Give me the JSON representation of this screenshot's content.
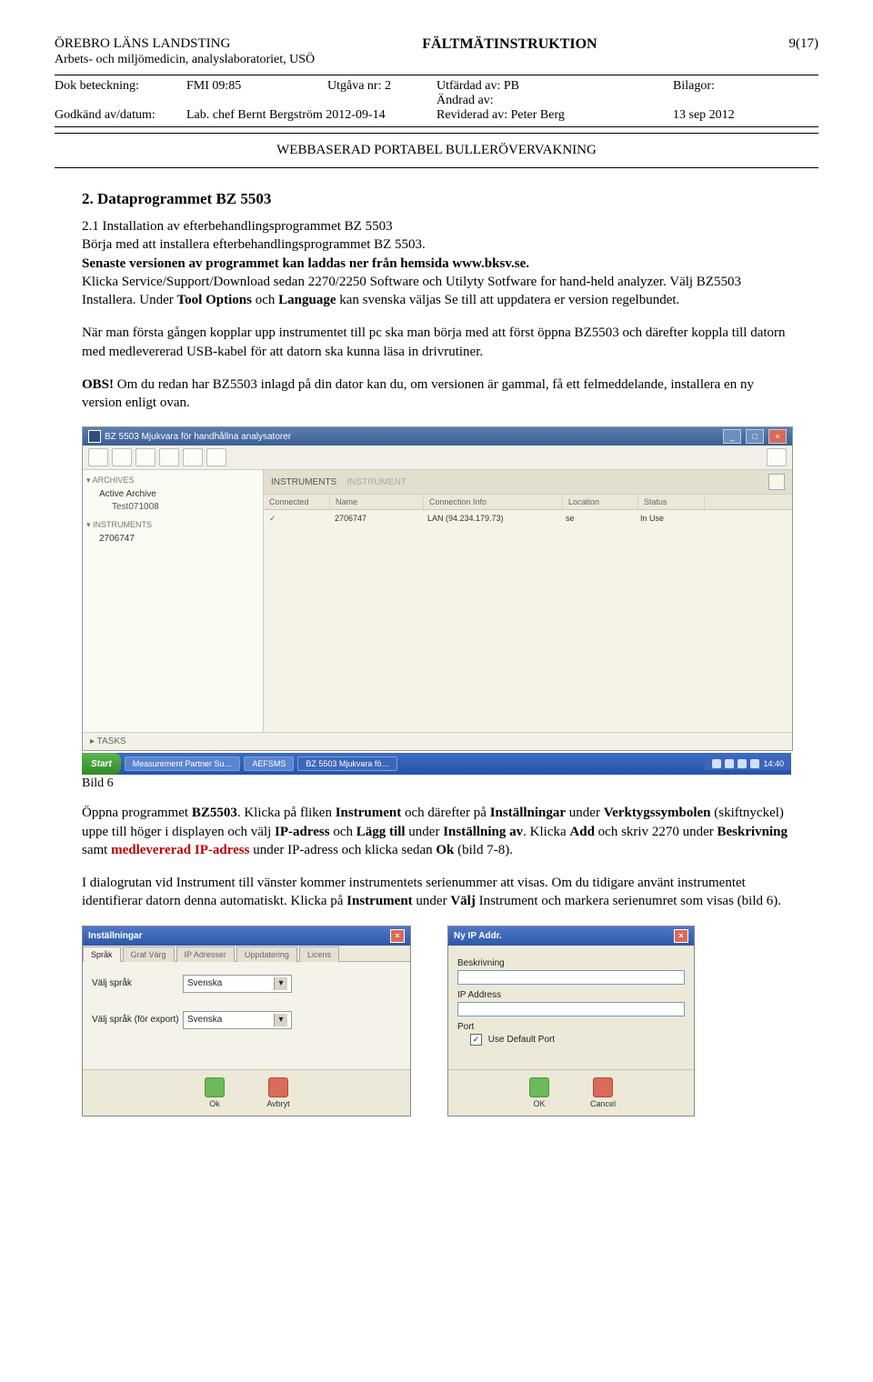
{
  "header": {
    "org": "ÖREBRO LÄNS LANDSTING",
    "title": "FÄLTMÄTINSTRUKTION",
    "page": "9(17)",
    "dept": "Arbets- och miljömedicin, analyslaboratoriet, USÖ",
    "row1": {
      "label1": "Dok beteckning:",
      "val1": "FMI 09:85",
      "label2": "Utgåva nr: 2",
      "val2a": "Utfärdad av: PB",
      "val2b": "Ändrad av:",
      "label3": "Bilagor:"
    },
    "row2": {
      "label1": "Godkänd av/datum:",
      "val1": "Lab. chef Bernt Bergström 2012-09-14",
      "val2": "Reviderad av: Peter Berg",
      "val3": "13 sep 2012"
    },
    "doc_title": "WEBBASERAD PORTABEL BULLERÖVERVAKNING"
  },
  "content": {
    "h2": "2. Dataprogrammet BZ 5503",
    "p1a": "2.1 Installation av efterbehandlingsprogrammet BZ 5503",
    "p1b": "Börja med att installera efterbehandlingsprogrammet BZ 5503.",
    "p1c": "Senaste versionen av programmet kan laddas ner från hemsida www.bksv.se.",
    "p1d": "Klicka Service/Support/Download sedan 2270/2250 Software och Utilyty Sotfware for hand-held analyzer. Välj BZ5503 Installera. Under ",
    "p1e_bold1": "Tool Options",
    "p1f": " och ",
    "p1e_bold2": "Language",
    "p1g": " kan svenska väljas Se till att uppdatera er version regelbundet.",
    "p2": "När man första gången kopplar upp instrumentet till pc ska man börja med att först öppna BZ5503 och därefter koppla till datorn med medlevererad USB-kabel för att datorn ska kunna läsa in drivrutiner.",
    "p3_a": "OBS!",
    "p3_b": " Om du redan har BZ5503 inlagd på din dator kan du, om versionen är gammal, få ett felmeddelande, installera en ny version enligt ovan.",
    "fig1_caption": "Bild 6",
    "p4_a": "Öppna programmet ",
    "p4_b": "BZ5503",
    "p4_c": ". Klicka på fliken ",
    "p4_d": "Instrument",
    "p4_e": " och därefter på ",
    "p4_f": "Inställningar",
    "p4_g": " under ",
    "p4_h": "Verktygssymbolen",
    "p4_i": " (skiftnyckel) uppe till höger i displayen och välj ",
    "p4_j": "IP-adress",
    "p4_k": " och ",
    "p4_l": "Lägg till",
    "p4_m": " under ",
    "p4_n": "Inställning av",
    "p4_o": ". Klicka ",
    "p4_p": "Add",
    "p4_q": " och skriv 2270 under ",
    "p4_r": "Beskrivning",
    "p4_s": " samt ",
    "p4_t": "medlevererad IP-adress",
    "p4_u": " under IP-adress och klicka sedan ",
    "p4_v": "Ok",
    "p4_w": " (bild 7-8).",
    "p5_a": "I dialogrutan vid Instrument till vänster kommer instrumentets serienummer att visas. Om du tidigare använt instrumentet identifierar datorn denna automatiskt. Klicka på ",
    "p5_b": "Instrument",
    "p5_c": " under ",
    "p5_d": "Välj",
    "p5_e": " Instrument och markera serienumret som visas (bild 6)."
  },
  "app": {
    "title": "BZ 5503 Mjukvara för handhållna analysatorer",
    "side": {
      "hdr1": "▾ ARCHIVES",
      "item1": "Active Archive",
      "sub1": "Test071008",
      "hdr2": "▾ INSTRUMENTS",
      "item2": "2706747"
    },
    "main": {
      "area_title": "INSTRUMENTS",
      "area_sub": "INSTRUMENT",
      "cols": {
        "c1": "Connected",
        "c2": "Name",
        "c3": "Connection Info",
        "c4": "Location",
        "c5": "Status"
      },
      "row": {
        "c1": "✓",
        "c2": "2706747",
        "c3": "LAN (94.234.179.73)",
        "c4": "se",
        "c5": "In Use"
      }
    },
    "tasks": "▸ TASKS",
    "taskbar": {
      "start": "Start",
      "items": [
        "Measurement Partner Su…",
        "AEFSMS",
        "BZ 5503 Mjukvara fö…"
      ],
      "time": "14:40"
    }
  },
  "dlg_settings": {
    "title": "Inställningar",
    "tabs": [
      "Språk",
      "Graf Värg",
      "IP Adresser",
      "Uppdatering",
      "Licens"
    ],
    "row1_label": "Välj språk",
    "row1_value": "Svenska",
    "row2_label": "Välj språk (för export)",
    "row2_value": "Svenska",
    "ok": "Ok",
    "cancel": "Avbryt"
  },
  "dlg_ip": {
    "title": "Ny  IP Addr.",
    "f1": "Beskrivning",
    "f2": "IP Address",
    "f3": "Port",
    "cb": "Use Default Port",
    "ok": "OK",
    "cancel": "Cancel"
  }
}
